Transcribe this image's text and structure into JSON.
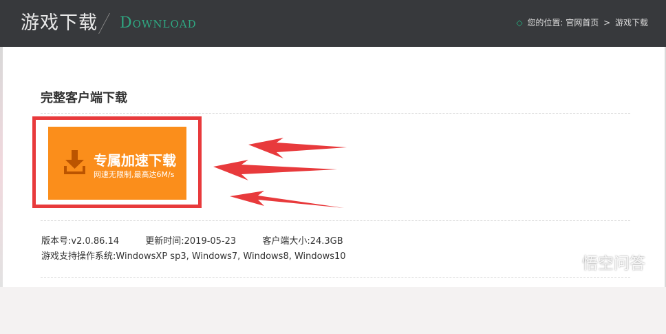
{
  "header": {
    "title_cn": "游戏下载",
    "title_en": "Download",
    "breadcrumb_prefix": "您的位置:",
    "breadcrumb_items": [
      "官网首页",
      "游戏下载"
    ]
  },
  "main": {
    "section_title": "完整客户端下载",
    "download_button": {
      "main_label": "专属加速下载",
      "sub_label": "网速无限制,最高达6M/s"
    },
    "info": {
      "version_label": "版本号:",
      "version_value": "v2.0.86.14",
      "update_label": "更新时间:",
      "update_value": "2019-05-23",
      "size_label": "客户端大小:",
      "size_value": "24.3GB",
      "os_label": "游戏支持操作系统:",
      "os_value": "WindowsXP sp3, Windows7, Windows8, Windows10"
    }
  },
  "watermark": {
    "text": "悟空问答"
  },
  "colors": {
    "header_bg": "#37393c",
    "accent_green": "#2fa882",
    "download_orange": "#fb8e1b",
    "highlight_red": "#e83a3c"
  }
}
